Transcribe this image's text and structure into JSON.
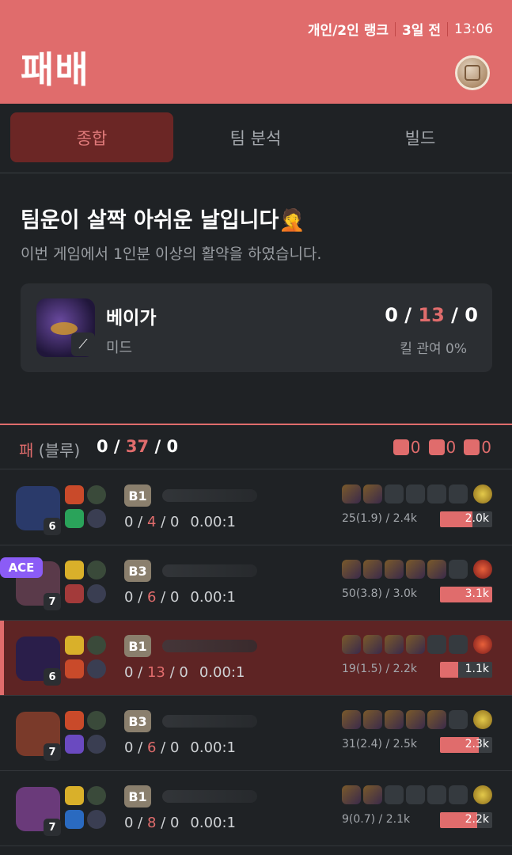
{
  "header": {
    "queue": "개인/2인 랭크",
    "ago": "3일 전",
    "time": "13:06",
    "result": "패배"
  },
  "tabs": [
    {
      "label": "종합",
      "active": true
    },
    {
      "label": "팀 분석",
      "active": false
    },
    {
      "label": "빌드",
      "active": false
    }
  ],
  "summary": {
    "headline": "팀운이 살짝 아쉬운 날입니다🤦",
    "subtitle": "이번 게임에서 1인분 이상의 활약을 하였습니다.",
    "champion": "베이가",
    "lane": "미드",
    "kills": "0",
    "deaths": "13",
    "assists": "0",
    "kill_participation": "킬 관여 0%"
  },
  "team": {
    "result": "패",
    "side": "(블루)",
    "kills": "0",
    "deaths": "37",
    "assists": "0",
    "objectives": [
      "0",
      "0",
      "0"
    ]
  },
  "players": [
    {
      "level": "6",
      "tier": "B1",
      "k": "0",
      "d": "4",
      "a": "0",
      "ratio": "0.00:1",
      "cs": "25(1.9) / 2.4k",
      "damage": "2.0k",
      "damage_frac": 0.62,
      "items_filled": 2,
      "ace": false,
      "me": false
    },
    {
      "level": "7",
      "tier": "B3",
      "k": "0",
      "d": "6",
      "a": "0",
      "ratio": "0.00:1",
      "cs": "50(3.8) / 3.0k",
      "damage": "3.1k",
      "damage_frac": 1.0,
      "items_filled": 5,
      "ace": true,
      "ace_label": "ACE",
      "me": false
    },
    {
      "level": "6",
      "tier": "B1",
      "k": "0",
      "d": "13",
      "a": "0",
      "ratio": "0.00:1",
      "cs": "19(1.5) / 2.2k",
      "damage": "1.1k",
      "damage_frac": 0.35,
      "items_filled": 4,
      "ace": false,
      "me": true
    },
    {
      "level": "7",
      "tier": "B3",
      "k": "0",
      "d": "6",
      "a": "0",
      "ratio": "0.00:1",
      "cs": "31(2.4) / 2.5k",
      "damage": "2.3k",
      "damage_frac": 0.74,
      "items_filled": 5,
      "ace": false,
      "me": false
    },
    {
      "level": "7",
      "tier": "B1",
      "k": "0",
      "d": "8",
      "a": "0",
      "ratio": "0.00:1",
      "cs": "9(0.7) / 2.1k",
      "damage": "2.2k",
      "damage_frac": 0.71,
      "items_filled": 2,
      "ace": false,
      "me": false
    }
  ]
}
